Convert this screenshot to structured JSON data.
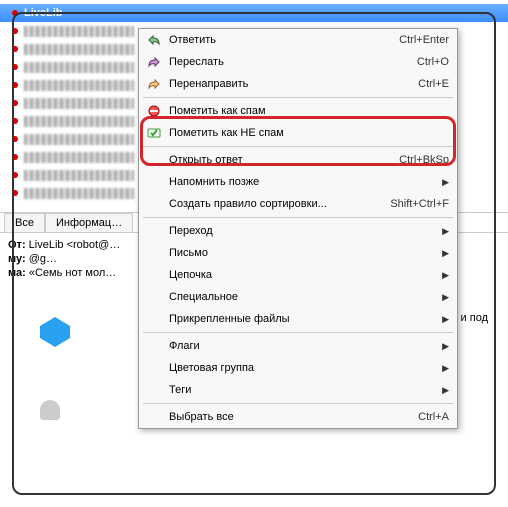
{
  "selected_message": "LiveLib",
  "tabs": {
    "all": "Все",
    "info": "Информац…"
  },
  "meta": {
    "from_label": "От:",
    "from_value": "LiveLib <robot@…",
    "to_label": "му:",
    "to_value": "@g…",
    "subject_label": "ма:",
    "subject_value": "«Семь нот мол…"
  },
  "menu": {
    "reply": "Ответить",
    "reply_sc": "Ctrl+Enter",
    "forward": "Переслать",
    "forward_sc": "Ctrl+O",
    "redirect": "Перенаправить",
    "redirect_sc": "Ctrl+E",
    "mark_spam": "Пометить как спам",
    "mark_not_spam": "Пометить как НЕ спам",
    "open_reply": "Открыть ответ",
    "open_reply_sc": "Ctrl+BkSp",
    "remind": "Напомнить позже",
    "sort_rule": "Создать правило сортировки...",
    "sort_rule_sc": "Shift+Ctrl+F",
    "goto": "Переход",
    "message": "Письмо",
    "thread": "Цепочка",
    "special": "Специальное",
    "attachments": "Прикрепленные файлы",
    "flags": "Флаги",
    "color_group": "Цветовая группа",
    "tags": "Теги",
    "select_all": "Выбрать все",
    "select_all_sc": "Ctrl+A"
  },
  "preview_text": "и под"
}
